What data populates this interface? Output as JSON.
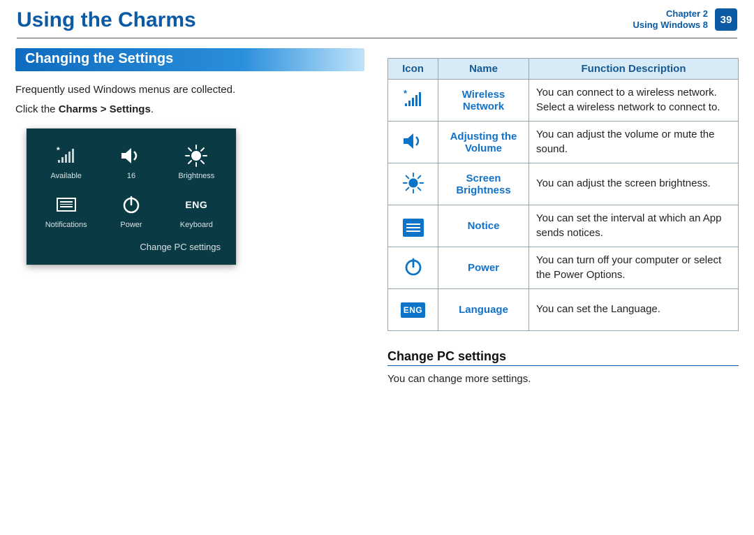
{
  "header": {
    "title": "Using the Charms",
    "chapter_line": "Chapter 2",
    "section_line": "Using Windows 8",
    "page_number": "39"
  },
  "left": {
    "banner": "Changing the Settings",
    "intro_plain": "Frequently used Windows menus are collected.",
    "intro_click_a": "Click the ",
    "intro_click_b": "Charms > Settings",
    "intro_click_c": ".",
    "charms": {
      "available_label": "Available",
      "volume_label": "16",
      "brightness_label": "Brightness",
      "notifications_label": "Notifications",
      "power_label": "Power",
      "keyboard_label": "Keyboard",
      "keyboard_icon_text": "ENG",
      "change_link": "Change PC settings"
    }
  },
  "table": {
    "headers": {
      "icon": "Icon",
      "name": "Name",
      "func": "Function Description"
    },
    "rows": [
      {
        "icon": "wireless-icon",
        "name": "Wireless Network",
        "desc": "You can connect to a wireless network. Select a wireless network to connect to."
      },
      {
        "icon": "volume-icon",
        "name": "Adjusting the Volume",
        "desc": "You can adjust the volume or mute the sound."
      },
      {
        "icon": "brightness-icon",
        "name": "Screen Brightness",
        "desc": "You can adjust the screen brightness."
      },
      {
        "icon": "notice-icon",
        "name": "Notice",
        "desc": "You can set the interval at which an App sends notices."
      },
      {
        "icon": "power-icon",
        "name": "Power",
        "desc": "You can turn off your computer or select the Power Options."
      },
      {
        "icon": "language-icon",
        "icon_text": "ENG",
        "name": "Language",
        "desc": "You can set the Language."
      }
    ]
  },
  "subsection": {
    "heading": "Change PC settings",
    "text": "You can change more settings."
  }
}
